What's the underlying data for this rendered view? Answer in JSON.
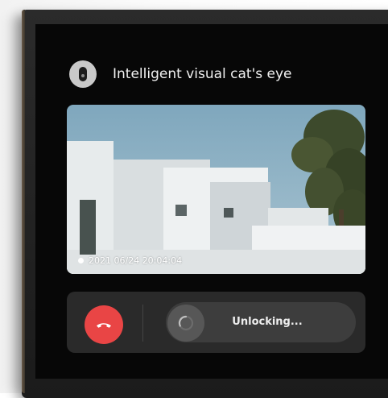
{
  "header": {
    "title": "Intelligent visual cat's eye",
    "icon": "camera-lens-icon"
  },
  "video": {
    "timestamp": "2021 06/24 20:04:04",
    "recording_indicator": "rec-dot"
  },
  "controls": {
    "hangup_icon": "phone-hangup-icon",
    "unlock_label": "Unlocking...",
    "unlock_icon": "loading-spinner-icon"
  },
  "colors": {
    "screen_bg": "#070707",
    "panel_bg": "#2a2a2a",
    "hangup_red": "#e94545",
    "slider_bg": "#3d3d3d",
    "text_light": "#f1f1f1"
  }
}
